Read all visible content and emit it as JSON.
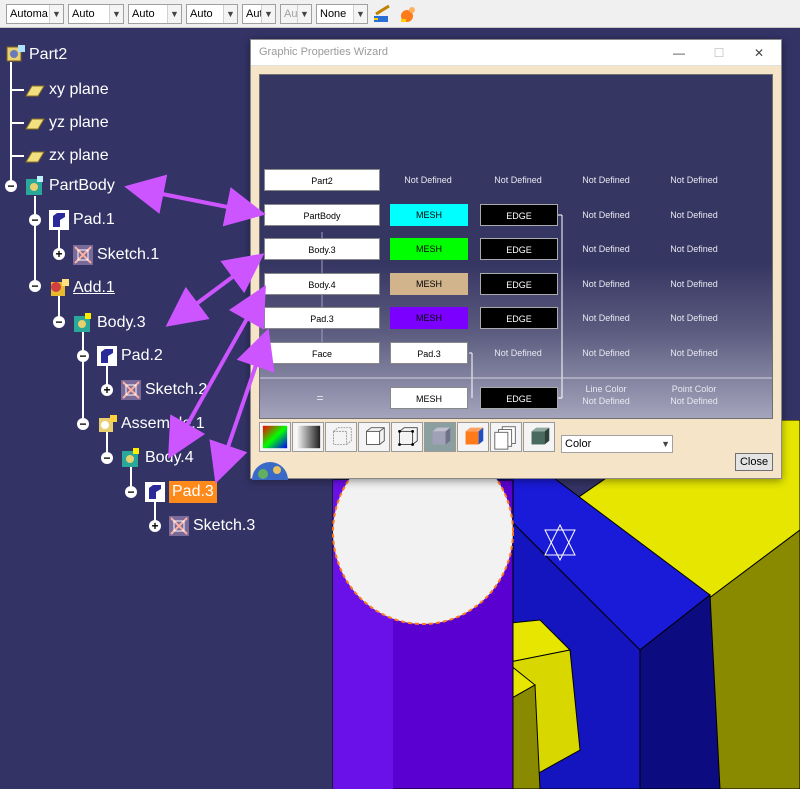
{
  "toolbar": {
    "selects": [
      {
        "value": "Automa"
      },
      {
        "value": "Auto"
      },
      {
        "value": "Auto"
      },
      {
        "value": "Auto"
      },
      {
        "value": "Aut"
      },
      {
        "value": "Aut",
        "disabled": true
      },
      {
        "value": "None"
      }
    ],
    "icons": [
      "paintbrush-icon",
      "painter-icon"
    ]
  },
  "tree": {
    "nodes": [
      {
        "label": "Part2",
        "icon": "part-icon"
      },
      {
        "label": "xy plane",
        "icon": "plane-icon"
      },
      {
        "label": "yz plane",
        "icon": "plane-icon"
      },
      {
        "label": "zx plane",
        "icon": "plane-icon"
      },
      {
        "label": "PartBody",
        "icon": "body-icon"
      },
      {
        "label": "Pad.1",
        "icon": "pad-icon"
      },
      {
        "label": "Sketch.1",
        "icon": "sketch-icon"
      },
      {
        "label": "Add.1",
        "icon": "add-icon"
      },
      {
        "label": "Body.3",
        "icon": "body-icon"
      },
      {
        "label": "Pad.2",
        "icon": "pad-icon"
      },
      {
        "label": "Sketch.2",
        "icon": "sketch-icon"
      },
      {
        "label": "Assemble.1",
        "icon": "assemble-icon"
      },
      {
        "label": "Body.4",
        "icon": "body-icon"
      },
      {
        "label": "Pad.3",
        "icon": "pad-icon"
      },
      {
        "label": "Sketch.3",
        "icon": "sketch-icon"
      }
    ]
  },
  "dialog": {
    "title": "Graphic Properties Wizard",
    "rows": [
      {
        "name": "Part2",
        "mesh": "Not Defined",
        "edge": "Not Defined",
        "col4": "Not Defined",
        "col5": "Not Defined"
      },
      {
        "name": "PartBody",
        "mesh": "MESH",
        "edge": "EDGE",
        "col4": "Not Defined",
        "col5": "Not Defined",
        "mesh_color": "#00ffff"
      },
      {
        "name": "Body.3",
        "mesh": "MESH",
        "edge": "EDGE",
        "col4": "Not Defined",
        "col5": "Not Defined",
        "mesh_color": "#00ff00"
      },
      {
        "name": "Body.4",
        "mesh": "MESH",
        "edge": "EDGE",
        "col4": "Not Defined",
        "col5": "Not Defined",
        "mesh_color": "#d2b48c"
      },
      {
        "name": "Pad.3",
        "mesh": "MESH",
        "edge": "EDGE",
        "col4": "Not Defined",
        "col5": "Not Defined",
        "mesh_color": "#7b00ff"
      },
      {
        "name": "Face",
        "mesh": "Pad.3",
        "edge": "Not Defined",
        "col4": "Not Defined",
        "col5": "Not Defined"
      }
    ],
    "footer": {
      "equals": "=",
      "mesh": "MESH",
      "edge": "EDGE",
      "line_color_label": "Line Color",
      "line_color_value": "Not Defined",
      "point_color_label": "Point Color",
      "point_color_value": "Not Defined"
    },
    "icons": [
      "color-wheel-icon",
      "shading-icon",
      "wireframe-cube-icon",
      "outline-cube-icon",
      "points-cube-icon",
      "shaded-cube-icon",
      "orange-cube-icon",
      "layers-icon",
      "material-cube-icon"
    ],
    "color_select": "Color",
    "close_label": "Close"
  },
  "colors": {
    "background": "#333366",
    "arrow": "#cc55ff",
    "selected": "#ff8a1c",
    "model_blue": "#1a1ad9",
    "model_yellow": "#e6e600",
    "model_purple": "#6a00d8"
  }
}
